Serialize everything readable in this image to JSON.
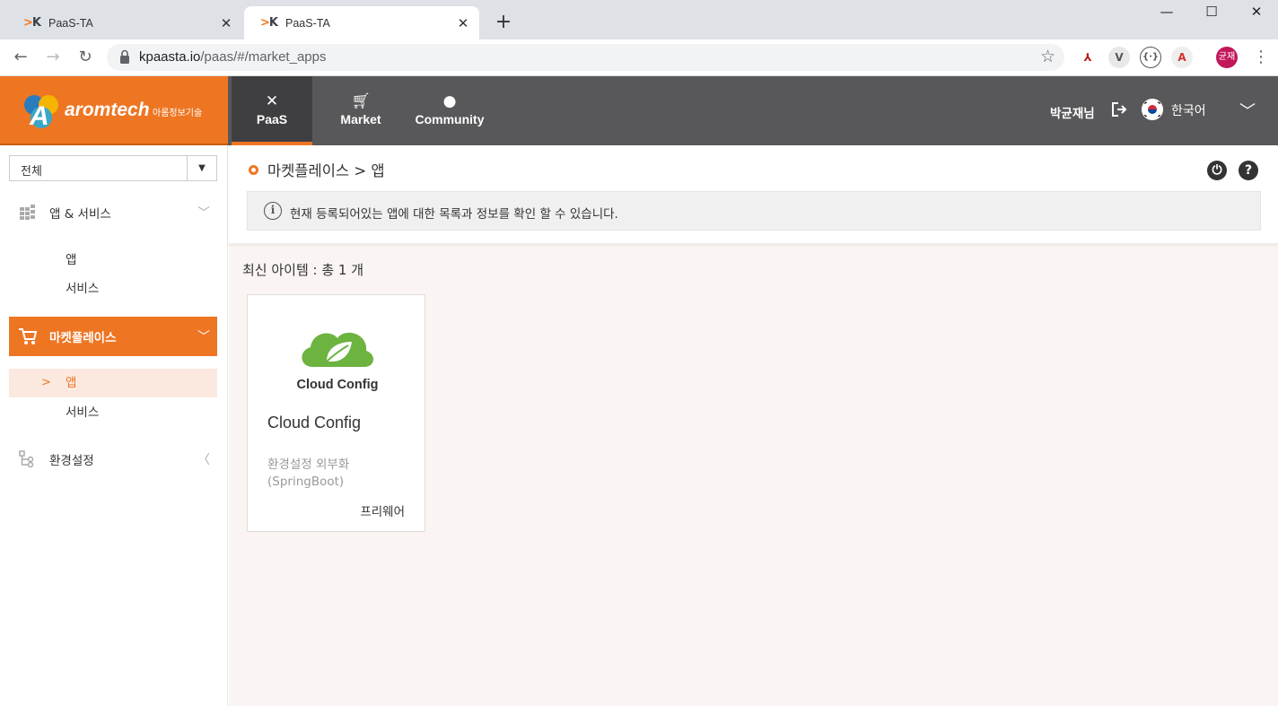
{
  "browser": {
    "tabs": [
      {
        "title": "PaaS-TA",
        "active": false
      },
      {
        "title": "PaaS-TA",
        "active": true
      }
    ],
    "url_host": "kpaasta.io",
    "url_path": "/paas/#/market_apps",
    "profile_initials": "균재"
  },
  "header": {
    "brand": "aromtech",
    "brand_sub": "아롬정보기술",
    "nav": [
      {
        "label": "PaaS",
        "icon": "tools-icon",
        "active": true
      },
      {
        "label": "Market",
        "icon": "cart-icon",
        "active": false
      },
      {
        "label": "Community",
        "icon": "chat-icon",
        "active": false
      }
    ],
    "username": "박균재님",
    "language": "한국어"
  },
  "sidebar": {
    "select_value": "전체",
    "menus": [
      {
        "label": "앱 & 서비스",
        "expanded": true,
        "subs": [
          "앱",
          "서비스"
        ]
      },
      {
        "label": "마켓플레이스",
        "expanded": true,
        "subs": [
          "앱",
          "서비스"
        ],
        "active_sub": "앱"
      },
      {
        "label": "환경설정",
        "expanded": false
      }
    ]
  },
  "main": {
    "breadcrumb": "마켓플레이스 > 앱",
    "info": "현재 등록되어있는 앱에 대한 목록과 정보를 확인 할 수 있습니다.",
    "count_label": "최신 아이템 : 총 1 개",
    "cards": [
      {
        "logo_text": "Cloud Config",
        "title": "Cloud Config",
        "desc": "환경설정 외부화 (SpringBoot)",
        "price": "프리웨어"
      }
    ]
  },
  "colors": {
    "accent": "#ee7623",
    "header_bg": "#58585a",
    "spring_green": "#6db33f"
  }
}
